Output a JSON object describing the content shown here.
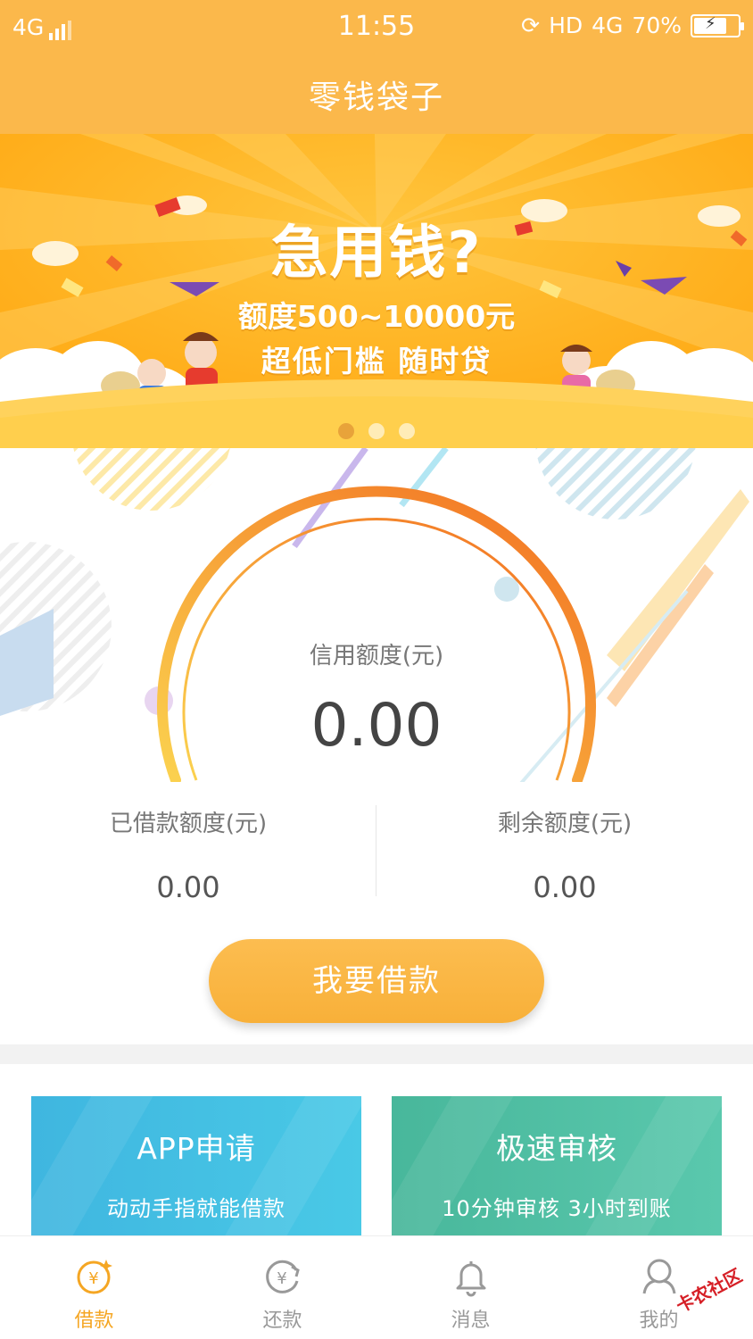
{
  "status_bar": {
    "network": "4G",
    "time": "11:55",
    "hd": "HD",
    "net_right": "4G",
    "battery": "70%"
  },
  "header": {
    "title": "零钱袋子"
  },
  "banner": {
    "title": "急用钱?",
    "line1": "额度500~10000元",
    "line2": "超低门槛 随时贷",
    "active_dot_index": 0,
    "dot_count": 3
  },
  "credit": {
    "label": "信用额度(元)",
    "value": "0.00",
    "borrowed_label": "已借款额度(元)",
    "borrowed_value": "0.00",
    "remaining_label": "剩余额度(元)",
    "remaining_value": "0.00",
    "borrow_button": "我要借款"
  },
  "cards": [
    {
      "title": "APP申请",
      "subtitle": "动动手指就能借款",
      "color": "#44bfe3"
    },
    {
      "title": "极速审核",
      "subtitle": "10分钟审核 3小时到账",
      "color": "#52c0a4"
    }
  ],
  "tabs": [
    {
      "label": "借款",
      "icon": "yen-coin-icon",
      "active": true
    },
    {
      "label": "还款",
      "icon": "yen-refresh-icon",
      "active": false
    },
    {
      "label": "消息",
      "icon": "bell-icon",
      "active": false
    },
    {
      "label": "我的",
      "icon": "person-icon",
      "active": false
    }
  ],
  "watermark": {
    "text": "卡农社区"
  },
  "colors": {
    "primary": "#fbb84b",
    "accent": "#f5a623",
    "ring_end": "#f26f21"
  }
}
